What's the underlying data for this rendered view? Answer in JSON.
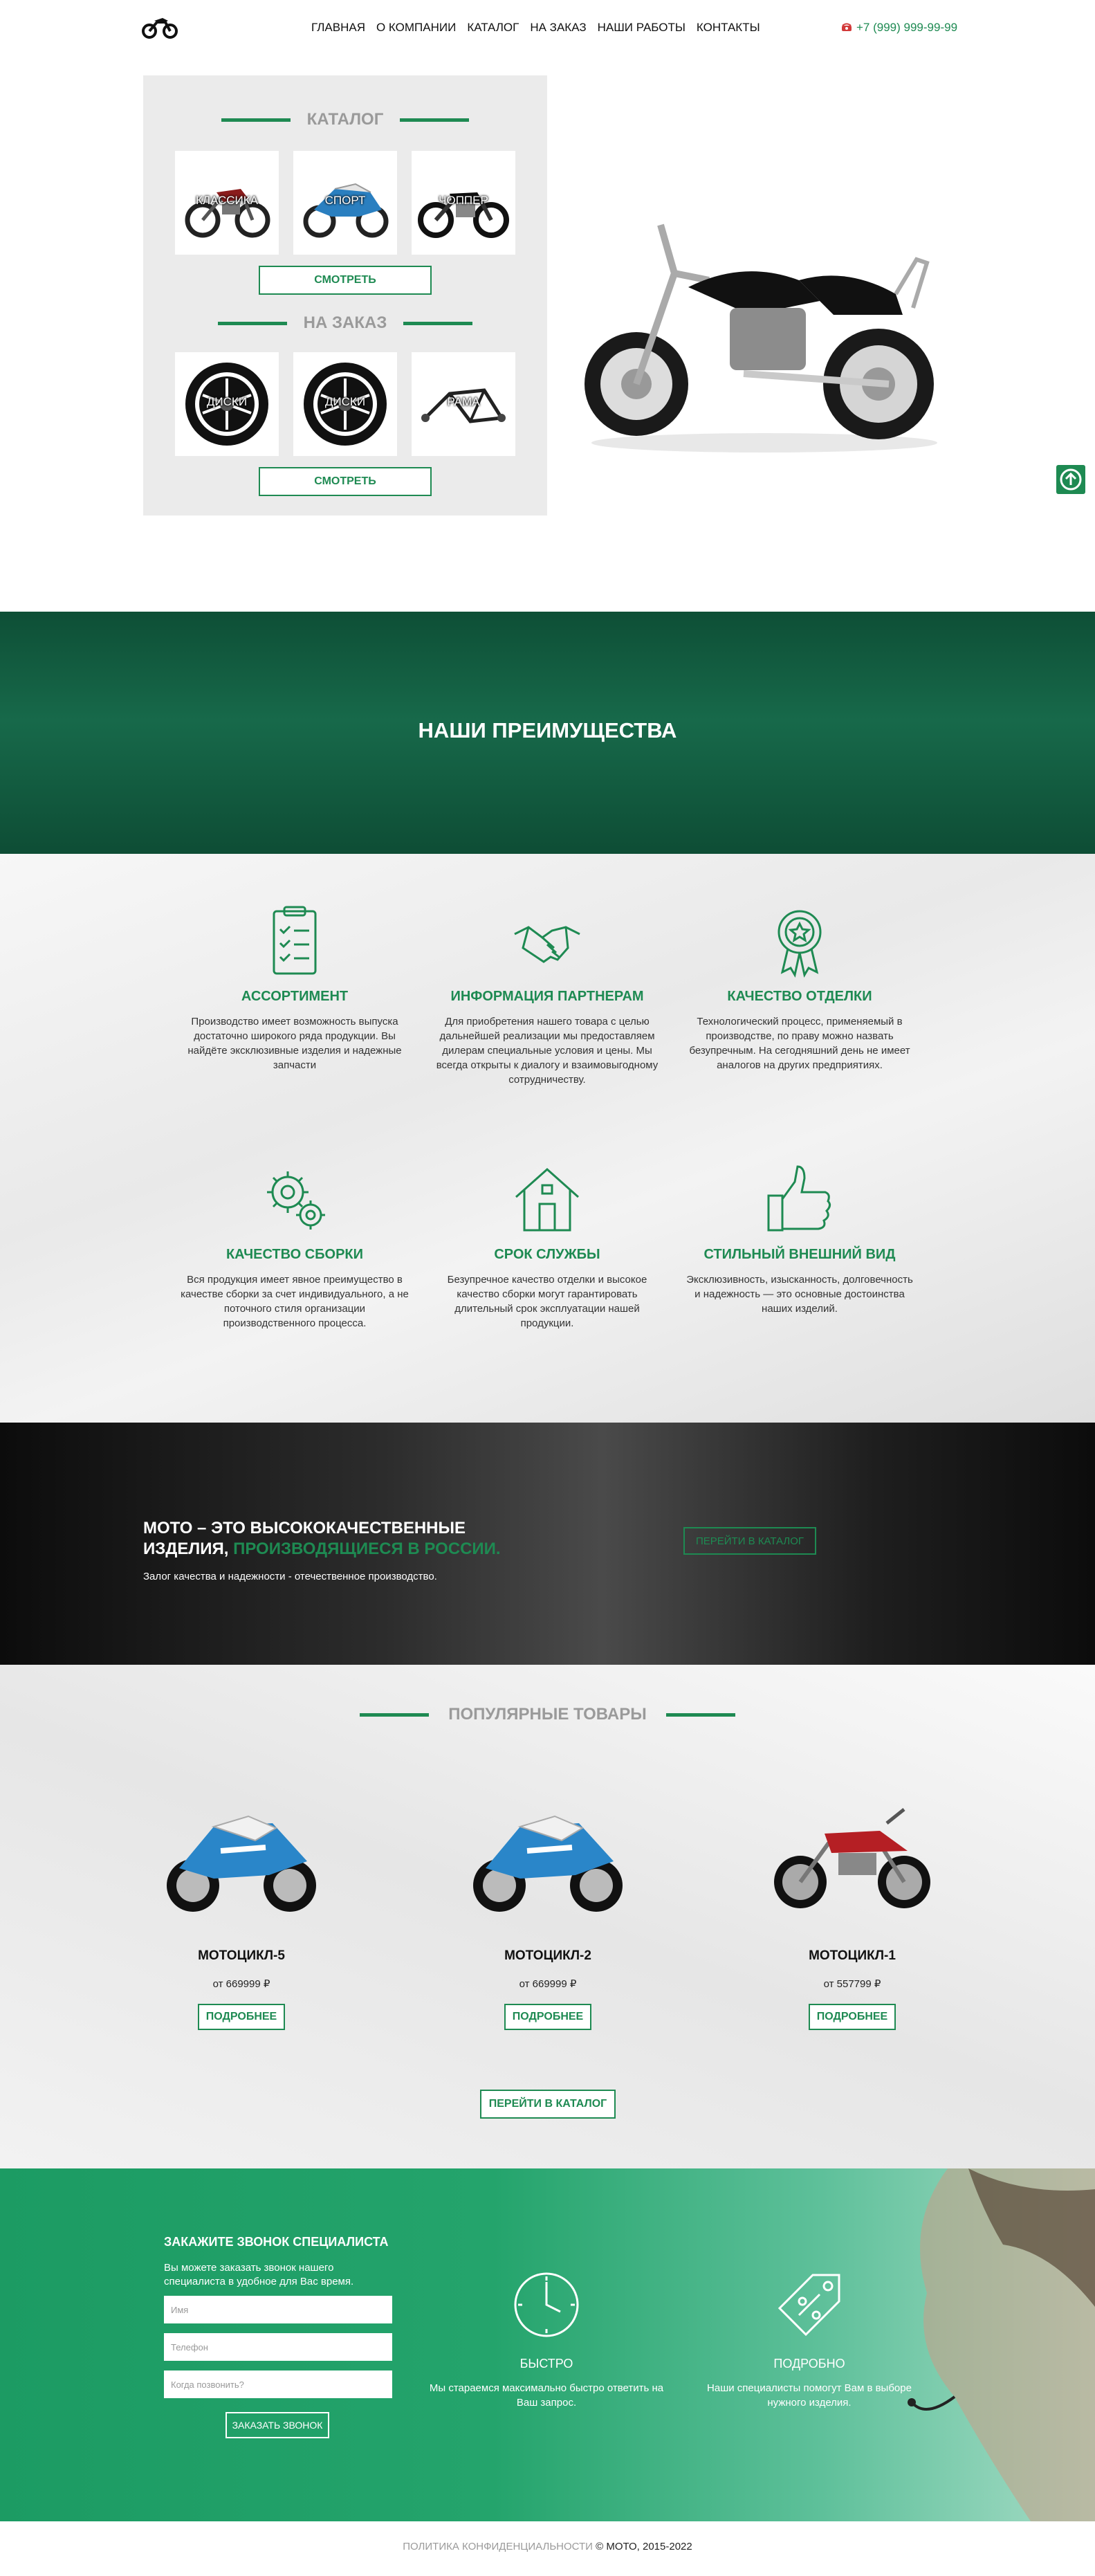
{
  "header": {
    "nav": [
      "ГЛАВНАЯ",
      "О КОМПАНИИ",
      "КАТАЛОГ",
      "НА ЗАКАЗ",
      "НАШИ РАБОТЫ",
      "КОНТАКТЫ"
    ],
    "phone": "+7 (999) 999-99-99",
    "logo_icon": "motorcycle-logo-icon",
    "phone_icon": "phone-icon"
  },
  "hero": {
    "catalog_title": "КАТАЛОГ",
    "catalog_items": [
      "КЛАССИКА",
      "СПОРТ",
      "ЧОППЕР"
    ],
    "catalog_button": "СМОТРЕТЬ",
    "order_title": "НА ЗАКАЗ",
    "order_items": [
      "ДИСКИ",
      "ДИСКИ",
      "РАМА"
    ],
    "order_button": "СМОТРЕТЬ"
  },
  "advantages": {
    "title": "НАШИ ПРЕИМУЩЕСТВА",
    "items": [
      {
        "icon": "clipboard-checklist-icon",
        "title": "АССОРТИМЕНТ",
        "text": "Производство имеет возможность выпуска достаточно широкого ряда продукции. Вы найдёте эксклюзивные изделия и надежные запчасти"
      },
      {
        "icon": "handshake-icon",
        "title": "ИНФОРМАЦИЯ ПАРТНЕРАМ",
        "text": "Для приобретения нашего товара с целью дальнейшей реализации мы предоставляем дилерам специальные условия и цены. Мы всегда открыты к диалогу и взаимовыгодному сотрудничеству."
      },
      {
        "icon": "award-ribbon-icon",
        "title": "КАЧЕСТВО ОТДЕЛКИ",
        "text": "Технологический процесс, применяемый в производстве, по праву можно назвать безупречным. На сегодняшний день не имеет аналогов на других предприятиях."
      },
      {
        "icon": "gears-icon",
        "title": "КАЧЕСТВО СБОРКИ",
        "text": "Вся продукция имеет явное преимущество в качестве сборки за счет индивидуального, а не поточного стиля организации производственного процесса."
      },
      {
        "icon": "house-icon",
        "title": "СРОК СЛУЖБЫ",
        "text": "Безупречное качество отделки и высокое качество сборки могут гарантировать длительный срок эксплуатации нашей продукции."
      },
      {
        "icon": "thumbs-up-icon",
        "title": "СТИЛЬНЫЙ ВНЕШНИЙ ВИД",
        "text": "Эксклюзивность, изысканность, долговечность и надежность — это основные достоинства наших изделий."
      }
    ]
  },
  "promo": {
    "head_white": "МОТО – ЭТО ВЫСОКОКАЧЕСТВЕННЫЕ ИЗДЕЛИЯ,",
    "head_green": "ПРОИЗВОДЯЩИЕСЯ В РОССИИ.",
    "subtitle": "Залог качества и надежности - отечественное производство.",
    "button": "ПЕРЕЙТИ В КАТАЛОГ"
  },
  "popular": {
    "title": "ПОПУЛЯРНЫЕ ТОВАРЫ",
    "products": [
      {
        "name": "МОТОЦИКЛ-5",
        "price": "от 669999 ₽",
        "button": "ПОДРОБНЕЕ"
      },
      {
        "name": "МОТОЦИКЛ-2",
        "price": "от 669999 ₽",
        "button": "ПОДРОБНЕЕ"
      },
      {
        "name": "МОТОЦИКЛ-1",
        "price": "от 557799 ₽",
        "button": "ПОДРОБНЕЕ"
      }
    ],
    "catalog_button": "ПЕРЕЙТИ В КАТАЛОГ"
  },
  "callback": {
    "title": "ЗАКАЖИТЕ ЗВОНОК СПЕЦИАЛИСТА",
    "text": "Вы можете заказать звонок нашего специалиста в удобное для Вас время.",
    "fields": [
      "Имя",
      "Телефон",
      "Когда позвонить?"
    ],
    "button": "ЗАКАЗАТЬ ЗВОНОК",
    "features": [
      {
        "icon": "clock-icon",
        "title": "БЫСТРО",
        "text": "Мы стараемся максимально быстро ответить на Ваш запрос."
      },
      {
        "icon": "price-tag-icon",
        "title": "ПОДРОБНО",
        "text": "Наши специалисты помогут Вам в выборе нужного изделия."
      }
    ]
  },
  "footer": {
    "policy_link": "ПОЛИТИКА КОНФИДЕНЦИАЛЬНОСТИ",
    "copyright": "© МОТО, 2015-2022"
  },
  "colors": {
    "accent": "#1e8a52",
    "dark_green": "#0e4f36",
    "muted": "#9a9a9a"
  }
}
